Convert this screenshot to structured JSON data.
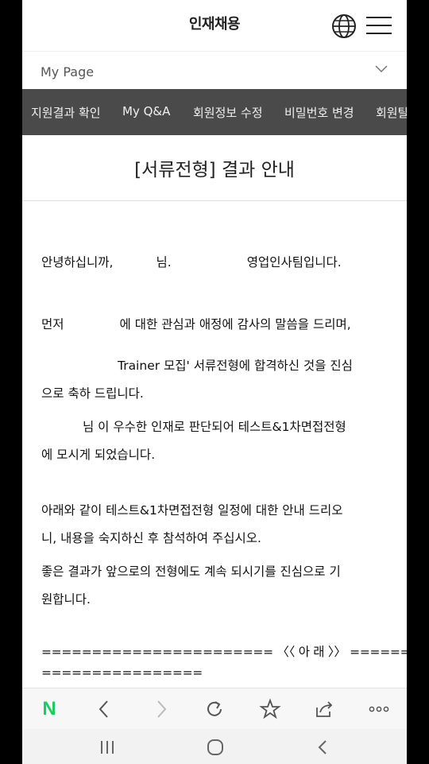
{
  "header": {
    "title": "인재채용"
  },
  "subnav": {
    "label": "My Page"
  },
  "tabs": [
    "지원결과 확인",
    "My Q&A",
    "회원정보 수정",
    "비밀번호 변경",
    "회원탈"
  ],
  "page": {
    "heading": "[서류전형] 결과 안내"
  },
  "content": {
    "greeting_a": "안녕하십니까,",
    "greeting_b": "님.",
    "greeting_c": "영업인사팀입니다.",
    "thanks_a": "먼저",
    "thanks_b": "에 대한 관심과 애정에 감사의 말씀을 드리며,",
    "congrats_line1": "Trainer 모집' 서류전형에 합격하신 것을 진심",
    "congrats_line2": "으로 축하 드립니다.",
    "selected_line1": "님 이 우수한 인재로 판단되어 테스트&1차면접전형",
    "selected_line2": "에 모시게 되었습니다.",
    "notice_line1": "아래와 같이 테스트&1차면접전형 일정에 대한 안내 드리오",
    "notice_line2": "니, 내용을 숙지하신 후 참석하여 주십시오.",
    "wish_line1": "좋은 결과가 앞으로의 전형에도 계속 되시기를 진심으로 기",
    "wish_line2": "원합니다.",
    "separator_line1": "======================= 〈〈 아  래 〉〉 ========",
    "separator_line2": "================"
  },
  "browser_toolbar": {
    "logo": "N",
    "icons": [
      "back-icon",
      "forward-icon",
      "refresh-icon",
      "bookmark-star-icon",
      "share-icon",
      "more-icon"
    ]
  },
  "colors": {
    "tabbar_bg": "#4a4a4a",
    "naver_green": "#19ce60"
  }
}
